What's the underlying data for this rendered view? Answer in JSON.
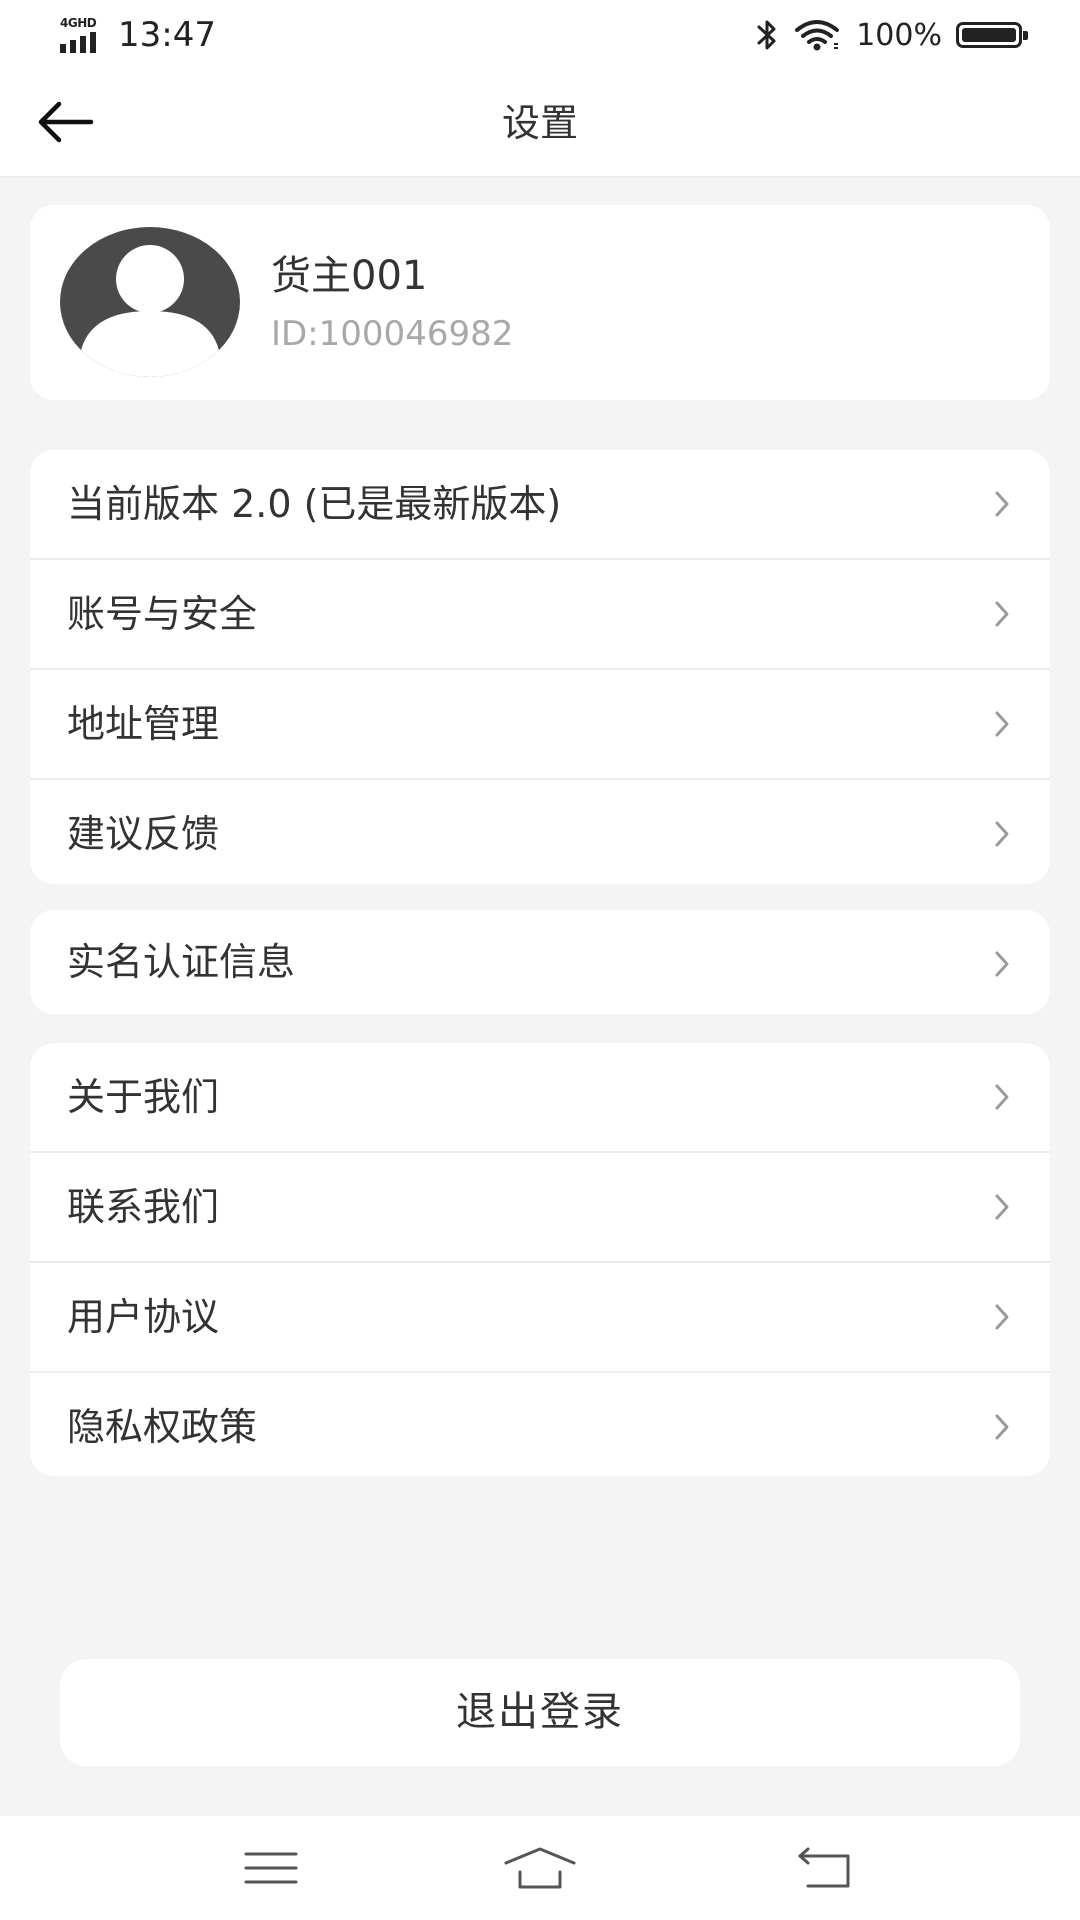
{
  "status_bar": {
    "network": "4GHD",
    "time": "13:47",
    "battery": "100%",
    "icons": [
      "signal-icon",
      "bluetooth-icon",
      "wifi-icon",
      "battery-icon"
    ]
  },
  "header": {
    "title": "设置",
    "back_icon": "back-arrow-icon"
  },
  "profile": {
    "name": "货主001",
    "id": "ID:100046982",
    "avatar_icon": "default-avatar-icon"
  },
  "menu_groups": [
    {
      "items": [
        {
          "label": "当前版本 2.0 (已是最新版本)"
        },
        {
          "label": "账号与安全"
        },
        {
          "label": "地址管理"
        },
        {
          "label": "建议反馈"
        }
      ]
    },
    {
      "items": [
        {
          "label": "实名认证信息"
        }
      ]
    },
    {
      "items": [
        {
          "label": "关于我们"
        },
        {
          "label": "联系我们"
        },
        {
          "label": "用户协议"
        },
        {
          "label": "隐私权政策"
        }
      ]
    }
  ],
  "logout": {
    "label": "退出登录"
  },
  "nav_bar": {
    "icons": [
      "menu-icon",
      "home-icon",
      "back-icon"
    ]
  },
  "colors": {
    "background": "#f4f4f4",
    "card": "#ffffff",
    "text": "#333333",
    "secondary_text": "#a8a8a8",
    "avatar": "#4a4a4a",
    "chevron": "#9a9a9a"
  }
}
